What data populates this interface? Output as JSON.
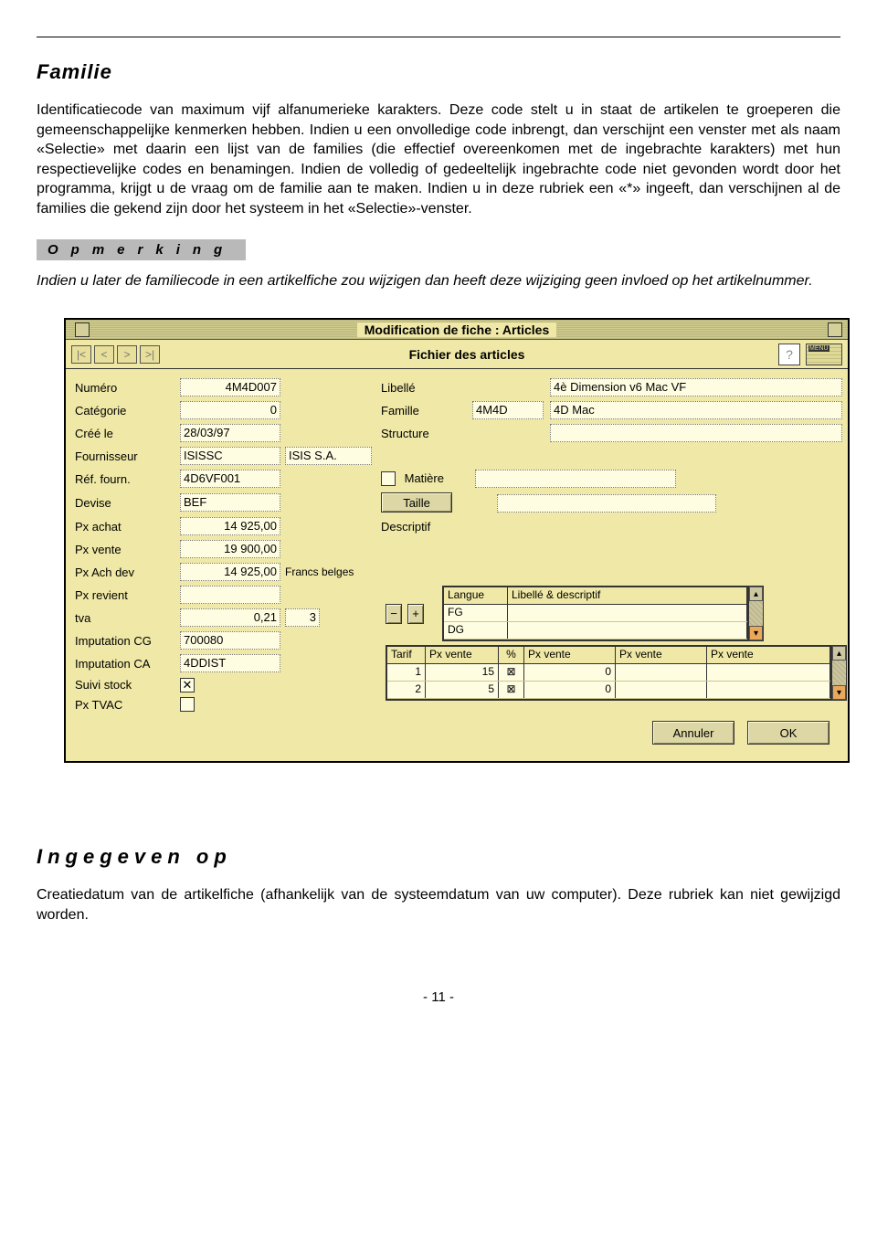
{
  "doc": {
    "section1_title": "Familie",
    "para1": "Identificatiecode van maximum vijf alfanumerieke karakters. Deze code stelt u in staat de artikelen te groeperen die gemeenschappelijke kenmerken hebben. Indien u een onvolledige code inbrengt, dan verschijnt een venster met als naam «Selectie» met daarin een lijst van de families (die effectief overeenkomen met de ingebrachte karakters) met hun respectievelijke codes en benamingen. Indien de volledig of gedeeltelijk ingebrachte code niet gevonden wordt door het programma, krijgt u de vraag om de familie aan te maken. Indien u in deze rubriek een «*» ingeeft, dan verschijnen al de families die gekend zijn door het systeem in het «Selectie»-venster.",
    "badge": "Opmerking",
    "para2": "Indien u later de familiecode in een artikelfiche zou wijzigen dan heeft deze wijziging geen invloed op het artikelnummer.",
    "section2_title": "Ingegeven op",
    "para3": "Creatiedatum van de artikelfiche (afhankelijk van de systeemdatum van uw computer). Deze rubriek kan niet gewijzigd worden.",
    "page_number": "- 11 -"
  },
  "win": {
    "title": "Modification de fiche : Articles",
    "subtitle": "Fichier des articles",
    "help": "?",
    "menu_label": "MENU",
    "nav": {
      "first": "|<",
      "prev": "<",
      "next": ">",
      "last": ">|"
    },
    "labels": {
      "numero": "Numéro",
      "libelle": "Libellé",
      "categorie": "Catégorie",
      "famille": "Famille",
      "cree_le": "Créé le",
      "structure": "Structure",
      "fournisseur": "Fournisseur",
      "ref_fourn": "Réf. fourn.",
      "matiere": "Matière",
      "devise": "Devise",
      "taille": "Taille",
      "px_achat": "Px achat",
      "descriptif": "Descriptif",
      "px_vente": "Px vente",
      "px_ach_dev": "Px Ach dev",
      "francs_belges": "Francs belges",
      "px_revient": "Px revient",
      "langue": "Langue",
      "libelle_desc": "Libellé & descriptif",
      "tva": "tva",
      "imputation_cg": "Imputation CG",
      "imputation_ca": "Imputation CA",
      "suivi_stock": "Suivi stock",
      "px_tvac": "Px TVAC",
      "tarif": "Tarif",
      "percent": "%"
    },
    "values": {
      "numero": "4M4D007",
      "libelle": "4è Dimension v6 Mac VF",
      "categorie": "0",
      "famille_code": "4M4D",
      "famille_name": "4D Mac",
      "cree_le": "28/03/97",
      "fournisseur_code": "ISISSC",
      "fournisseur_name": "ISIS S.A.",
      "ref_fourn": "4D6VF001",
      "devise": "BEF",
      "px_achat": "14 925,00",
      "px_vente": "19 900,00",
      "px_ach_dev": "14 925,00",
      "tva_rate": "0,21",
      "tva_code": "3",
      "imputation_cg": "700080",
      "imputation_ca": "4DDIST",
      "suivi_stock_checked": "✕",
      "lang1": "FG",
      "lang2": "DG",
      "tarif1": "1",
      "tarif1_pv": "15",
      "tarif1_pv2": "0",
      "tarif2": "2",
      "tarif2_pv": "5",
      "tarif2_pv2": "0"
    },
    "buttons": {
      "minus": "−",
      "plus": "+",
      "annuler": "Annuler",
      "ok": "OK"
    }
  }
}
